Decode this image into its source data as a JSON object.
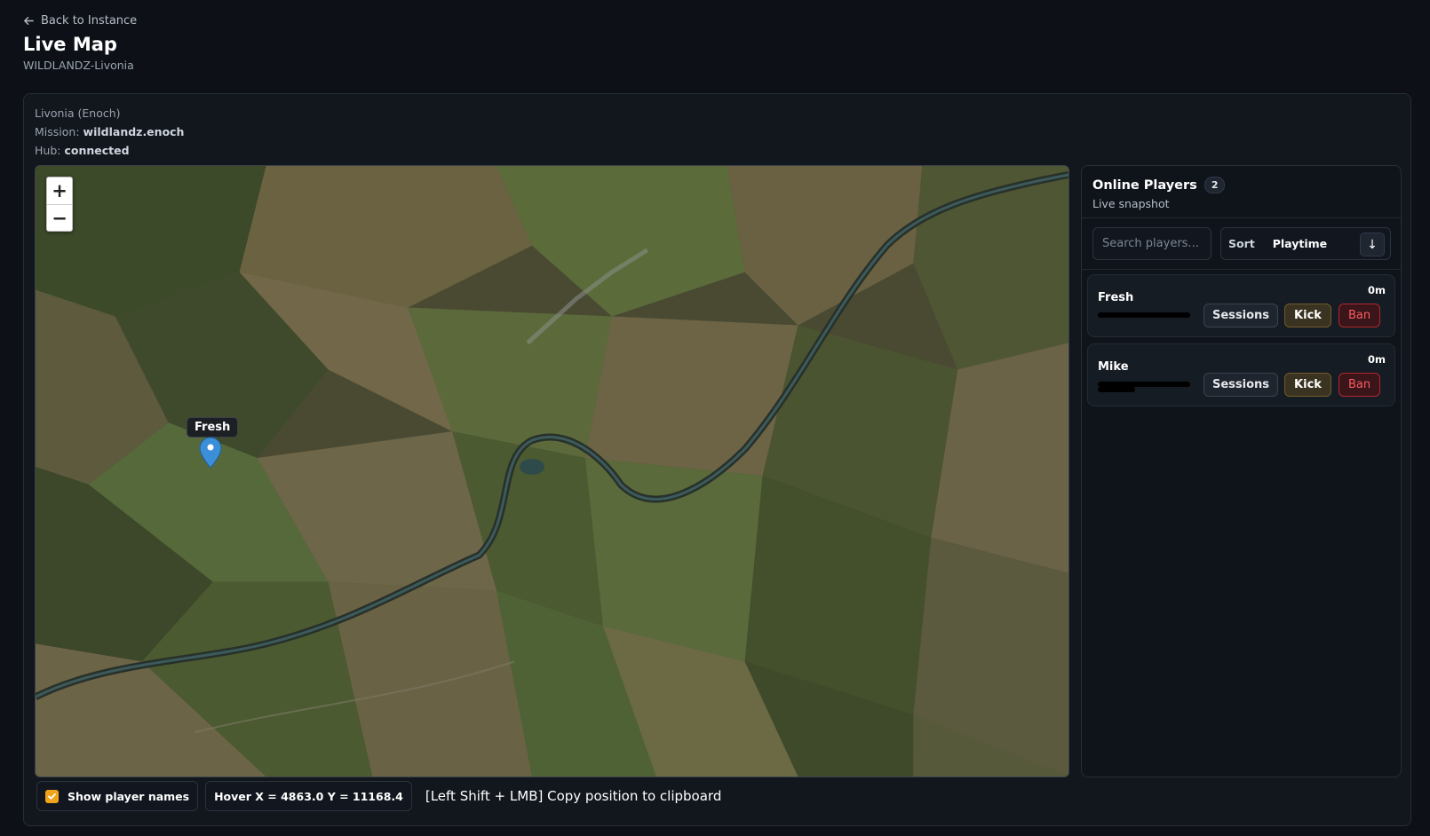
{
  "header": {
    "back_label": "Back to Instance",
    "title": "Live Map",
    "subtitle": "WILDLANDZ-Livonia"
  },
  "meta": {
    "map_name": "Livonia (Enoch)",
    "mission_label": "Mission:",
    "mission_value": "wildlandz.enoch",
    "hub_label": "Hub:",
    "hub_value": "connected"
  },
  "map": {
    "zoom_in": "+",
    "zoom_out": "−",
    "marker_name": "Fresh",
    "marker_color": "#3b8fd9"
  },
  "players_panel": {
    "title": "Online Players",
    "count": "2",
    "subtitle": "Live snapshot",
    "search_placeholder": "Search players...",
    "sort_label": "Sort",
    "sort_value": "Playtime",
    "sort_direction": "↓",
    "players": [
      {
        "name": "Fresh",
        "playtime": "0m",
        "sessions_label": "Sessions",
        "kick_label": "Kick",
        "ban_label": "Ban"
      },
      {
        "name": "Mike",
        "playtime": "0m",
        "sessions_label": "Sessions",
        "kick_label": "Kick",
        "ban_label": "Ban"
      }
    ]
  },
  "footer": {
    "show_names_label": "Show player names",
    "show_names_checked": true,
    "hover_coords": "Hover X = 4863.0 Y = 11168.4",
    "copy_hint": "[Left Shift + LMB] Copy position to clipboard"
  },
  "colors": {
    "accent": "#f0a41b",
    "danger": "#ff5a60",
    "background": "#0d1117"
  }
}
